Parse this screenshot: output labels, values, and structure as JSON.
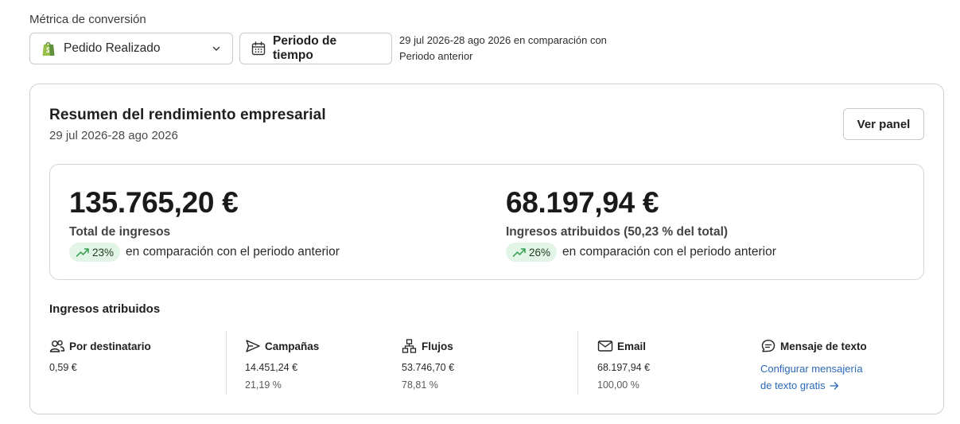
{
  "filters": {
    "metric_label": "Métrica de conversión",
    "metric_value": "Pedido Realizado",
    "period_button_label": "Periodo de tiempo",
    "period_info_line1": "29 jul 2026-28 ago 2026 en comparación con",
    "period_info_line2": "Periodo anterior"
  },
  "summary": {
    "title": "Resumen del rendimiento empresarial",
    "date_range": "29 jul 2026-28 ago 2026",
    "view_button": "Ver panel",
    "kpis": [
      {
        "value": "135.765,20 €",
        "label": "Total de ingresos",
        "change": "23%",
        "compare_text": "en comparación con el periodo anterior"
      },
      {
        "value": "68.197,94 €",
        "label": "Ingresos atribuidos (50,23 % del total)",
        "change": "26%",
        "compare_text": "en comparación con el periodo anterior"
      }
    ]
  },
  "attributed": {
    "title": "Ingresos atribuidos",
    "columns": [
      {
        "label": "Por destinatario",
        "icon": "people-icon",
        "value": "0,59 €",
        "percent": ""
      },
      {
        "label": "Campañas",
        "icon": "send-icon",
        "value": "14.451,24 €",
        "percent": "21,19 %"
      },
      {
        "label": "Flujos",
        "icon": "flow-icon",
        "value": "53.746,70 €",
        "percent": "78,81 %"
      },
      {
        "label": "Email",
        "icon": "mail-icon",
        "value": "68.197,94 €",
        "percent": "100,00 %"
      },
      {
        "label": "Mensaje de texto",
        "icon": "chat-icon",
        "link_line1": "Configurar mensajería",
        "link_line2": "de texto gratis"
      }
    ]
  },
  "colors": {
    "pill_bg": "#e3f5e6",
    "trend_green": "#2e9d4a",
    "link_blue": "#2b68b8",
    "shopify_green": "#5e8e3e"
  }
}
